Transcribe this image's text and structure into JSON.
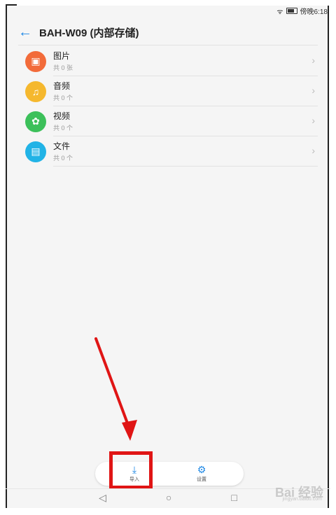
{
  "status": {
    "time": "傍晚6:18"
  },
  "header": {
    "title": "BAH-W09 (内部存储)"
  },
  "items": [
    {
      "name": "图片",
      "sub": "共 0 张",
      "icon": "image-icon",
      "color": "#f26b3a"
    },
    {
      "name": "音频",
      "sub": "共 0 个",
      "icon": "music-icon",
      "color": "#f5b82e"
    },
    {
      "name": "视频",
      "sub": "共 0 个",
      "icon": "video-reel-icon",
      "color": "#3cc05a"
    },
    {
      "name": "文件",
      "sub": "共 0 个",
      "icon": "document-icon",
      "color": "#21b3e6"
    }
  ],
  "bottombar": {
    "import_label": "导入",
    "settings_label": "设置"
  },
  "watermark": {
    "text": "Bai 经验",
    "sub": "jingyan.baidu.com"
  },
  "colors": {
    "accent": "#1e88e5",
    "highlight": "#e01515"
  }
}
